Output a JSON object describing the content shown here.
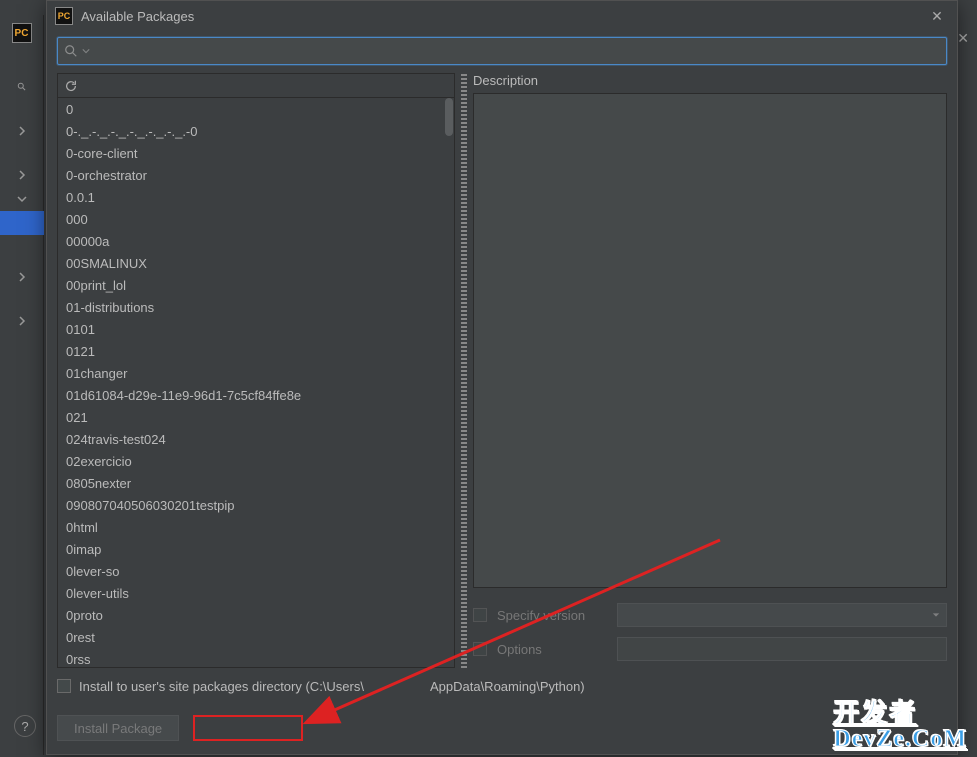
{
  "dialog": {
    "title": "Available Packages",
    "search_placeholder": "",
    "description_label": "Description",
    "specify_version_label": "Specify version",
    "options_label": "Options",
    "install_user_site_label": "Install to user's site packages directory (C:\\Users\\",
    "install_user_site_path": "AppData\\Roaming\\Python)",
    "install_button": "Install Package"
  },
  "packages": [
    "0",
    "0-._.-._.-._.-._.-._.-._.-0",
    "0-core-client",
    "0-orchestrator",
    "0.0.1",
    "000",
    "00000a",
    "00SMALINUX",
    "00print_lol",
    "01-distributions",
    "0101",
    "0121",
    "01changer",
    "01d61084-d29e-11e9-96d1-7c5cf84ffe8e",
    "021",
    "024travis-test024",
    "02exercicio",
    "0805nexter",
    "090807040506030201testpip",
    "0html",
    "0imap",
    "0lever-so",
    "0lever-utils",
    "0proto",
    "0rest",
    "0rss"
  ],
  "watermark": {
    "line1": "开发者",
    "line2": "DevZe.CoM"
  }
}
